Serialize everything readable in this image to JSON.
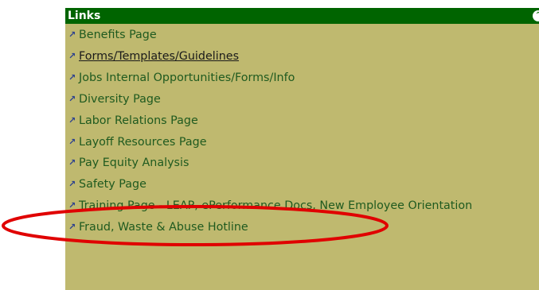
{
  "panel": {
    "title": "Links",
    "collapse_icon": "collapse-icon",
    "colors": {
      "header_bg": "#006400",
      "panel_bg": "#bfb96f",
      "link": "#1f5a1f",
      "annotation": "#e00000"
    }
  },
  "links": [
    {
      "label": "Benefits Page"
    },
    {
      "label": "Forms/Templates/Guidelines"
    },
    {
      "label": "Jobs Internal Opportunities/Forms/Info"
    },
    {
      "label": "Diversity Page"
    },
    {
      "label": "Labor Relations Page"
    },
    {
      "label": "Layoff Resources Page"
    },
    {
      "label": "Pay Equity Analysis"
    },
    {
      "label": "Safety Page"
    },
    {
      "label": "Training Page - LEAP, ePerformance Docs, New Employee Orientation"
    },
    {
      "label": "Fraud, Waste & Abuse Hotline"
    }
  ],
  "annotation": {
    "type": "ellipse",
    "highlighted_link": "Fraud, Waste & Abuse Hotline"
  }
}
